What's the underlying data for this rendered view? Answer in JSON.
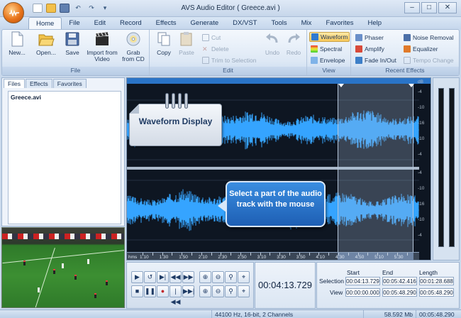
{
  "window": {
    "title": "AVS Audio Editor",
    "document": "( Greece.avi )"
  },
  "menu": [
    {
      "label": "Home",
      "active": true
    },
    {
      "label": "File"
    },
    {
      "label": "Edit"
    },
    {
      "label": "Record"
    },
    {
      "label": "Effects"
    },
    {
      "label": "Generate"
    },
    {
      "label": "DX/VST"
    },
    {
      "label": "Tools"
    },
    {
      "label": "Mix"
    },
    {
      "label": "Favorites"
    },
    {
      "label": "Help"
    }
  ],
  "ribbon": {
    "file": {
      "label": "File",
      "new": "New...",
      "open": "Open...",
      "save": "Save",
      "import_video": "Import from Video",
      "grab_cd": "Grab from CD"
    },
    "edit": {
      "label": "Edit",
      "copy": "Copy",
      "paste": "Paste",
      "cut": "Cut",
      "delete": "Delete",
      "trim": "Trim to Selection",
      "undo": "Undo",
      "redo": "Redo"
    },
    "view": {
      "label": "View",
      "waveform": "Waveform",
      "spectral": "Spectral",
      "envelope": "Envelope"
    },
    "recent": {
      "label": "Recent Effects",
      "phaser": "Phaser",
      "noise_removal": "Noise Removal",
      "amplify": "Amplify",
      "equalizer": "Equalizer",
      "fade": "Fade In/Out",
      "tempo": "Tempo Change"
    }
  },
  "left_panel": {
    "tabs": [
      "Files",
      "Effects",
      "Favorites"
    ],
    "files": [
      "Greece.avi"
    ]
  },
  "waveform": {
    "note_waveform": "Waveform Display",
    "note_select": "Select a part of the audio track with the mouse",
    "ruler_unit": "hms",
    "ruler_labels": [
      "1:10",
      "1:20",
      "1:30",
      "1:40",
      "1:50",
      "2:00",
      "2:10",
      "2:20",
      "2:30",
      "2:40",
      "2:50",
      "3:00",
      "3:10",
      "3:20",
      "3:30",
      "3:40",
      "3:50",
      "4:00",
      "4:10",
      "4:20",
      "4:30",
      "4:40",
      "4:50",
      "5:00",
      "5:10",
      "5:20",
      "5:30",
      "5:40"
    ],
    "db_unit": "dB",
    "db_labels": [
      "-4",
      "-10",
      "-16",
      "-10",
      "-4",
      "-4",
      "-10",
      "-16",
      "-10",
      "-4"
    ]
  },
  "transport": {
    "current_time": "00:04:13.729"
  },
  "selection_info": {
    "headers": [
      "Start",
      "End",
      "Length"
    ],
    "selection_label": "Selection",
    "view_label": "View",
    "selection": [
      "00:04:13.729",
      "00:05:42.416",
      "00:01:28.688"
    ],
    "view": [
      "00:00:00.000",
      "00:05:48.290",
      "00:05:48.290"
    ]
  },
  "status": {
    "format": "44100 Hz, 16-bit, 2 Channels",
    "size": "58.592 Mb",
    "duration": "00:05:48.290"
  },
  "colors": {
    "accent": "#2a74c7",
    "wave": "#35a4ff",
    "selection": "#aabed7"
  }
}
